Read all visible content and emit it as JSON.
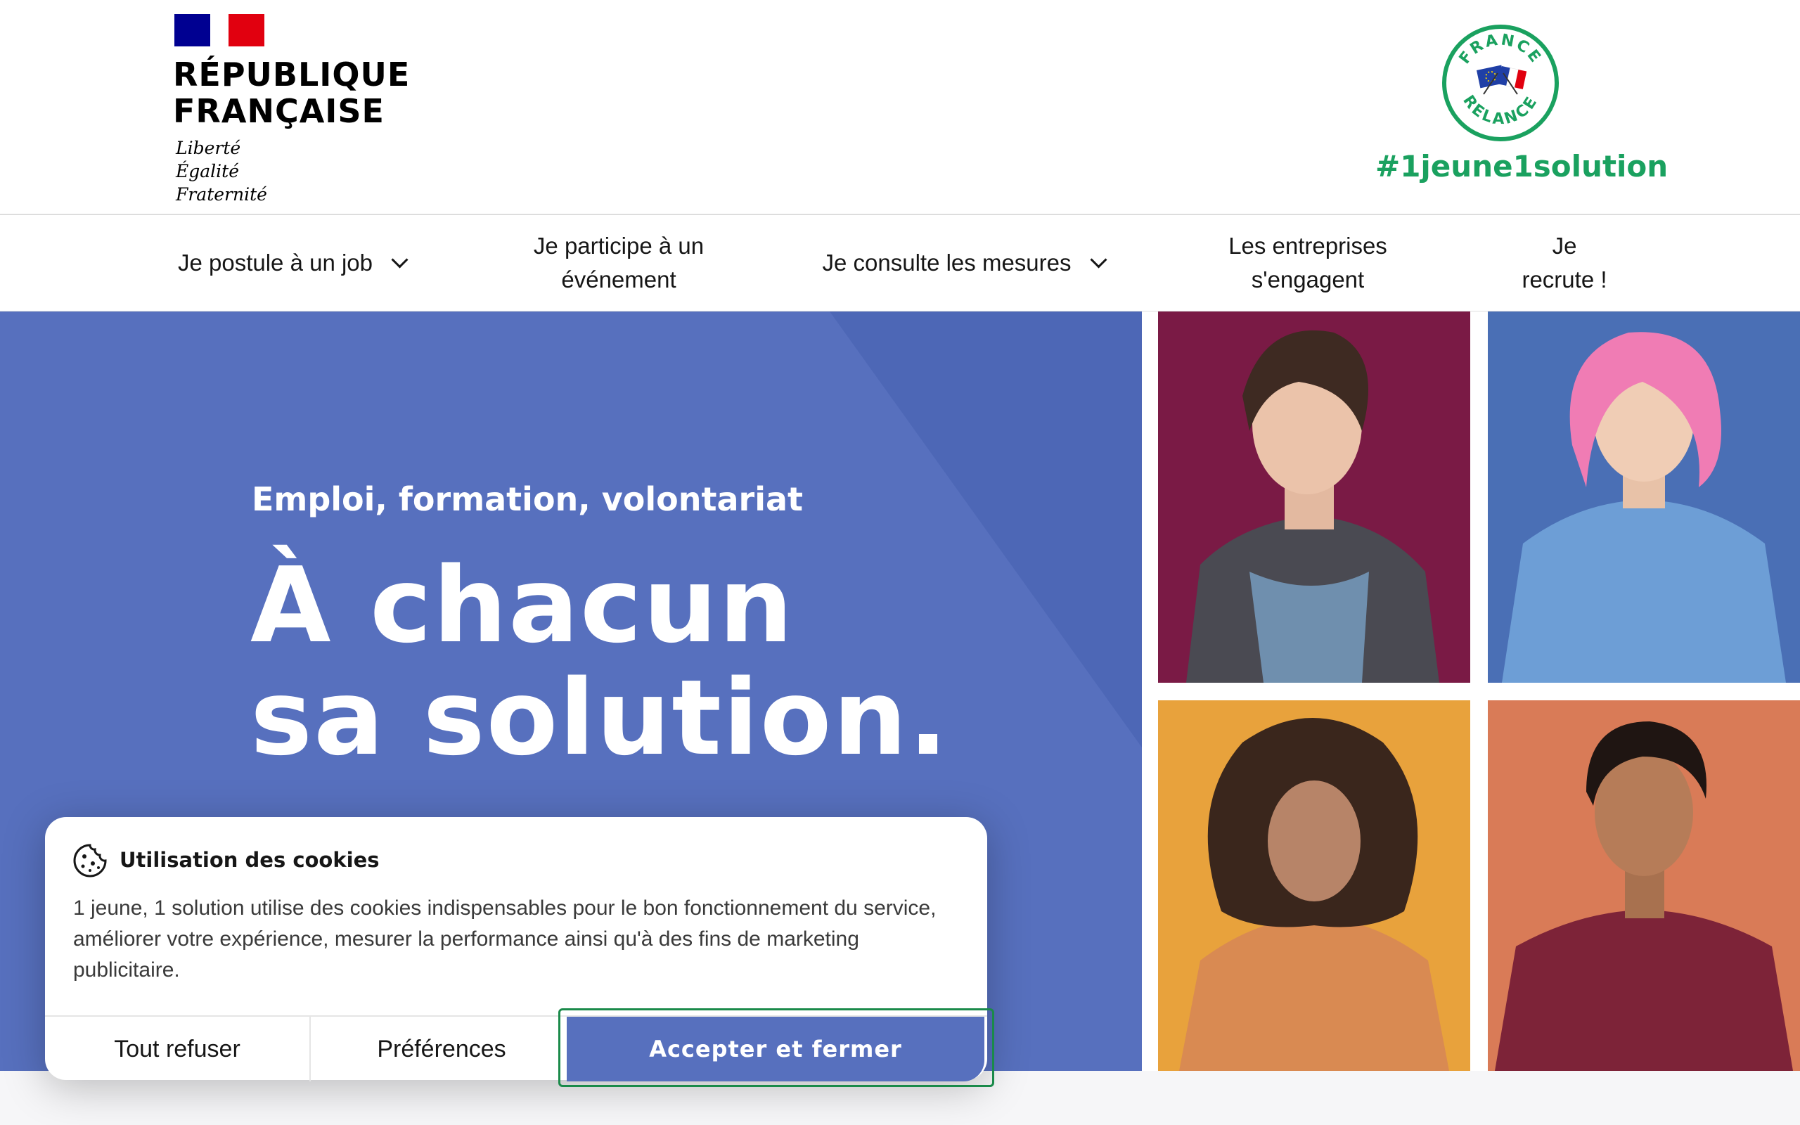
{
  "header": {
    "rf_title_lines": [
      "RÉPUBLIQUE",
      "FRANÇAISE"
    ],
    "rf_motto_lines": [
      "Liberté",
      "Égalité",
      "Fraternité"
    ],
    "relance_logo_top": "FRANCE",
    "relance_logo_bottom": "RELANCE",
    "hashtag": "#1jeune1solution",
    "hashtag_color": "#1aa15f"
  },
  "nav": {
    "items": [
      {
        "label": "Je postule à un job",
        "has_dropdown": true
      },
      {
        "label": "Je participe à un\névénement",
        "has_dropdown": false
      },
      {
        "label": "Je consulte les mesures",
        "has_dropdown": true
      },
      {
        "label": "Les entreprises\ns'engagent",
        "has_dropdown": false
      },
      {
        "label": "Je\nrecrute !",
        "has_dropdown": false
      }
    ]
  },
  "hero": {
    "eyebrow": "Emploi, formation, volontariat",
    "title_lines": [
      "À chacun",
      "sa solution."
    ],
    "background_color": "#5770be",
    "photo_backgrounds": [
      "#7a1a45",
      "#4a6fb5",
      "#e8a23c",
      "#d97b57"
    ]
  },
  "cookie_banner": {
    "icon": "cookie-icon",
    "title": "Utilisation des cookies",
    "text": "1 jeune, 1 solution utilise des cookies indispensables pour le bon fonctionnement du service, améliorer votre expérience, mesurer la performance ainsi qu'à des fins de marketing publicitaire.",
    "refuse_label": "Tout refuser",
    "prefs_label": "Préférences",
    "accept_label": "Accepter et fermer",
    "accent_color": "#5770be"
  }
}
